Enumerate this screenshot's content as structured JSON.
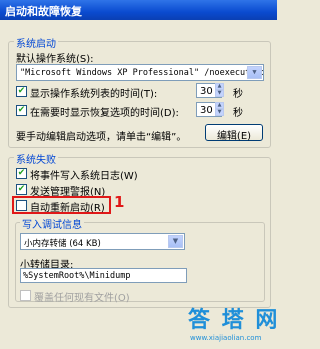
{
  "window": {
    "title": "启动和故障恢复"
  },
  "system_startup": {
    "legend": "系统启动",
    "default_os_label": "默认操作系统(S):",
    "default_os_value": "\"Microsoft Windows XP Professional\" /noexecute=optin",
    "show_os_list": {
      "checked": true,
      "label": "显示操作系统列表的时间(T):",
      "value": "30",
      "unit": "秒"
    },
    "show_recovery": {
      "checked": true,
      "label": "在需要时显示恢复选项的时间(D):",
      "value": "30",
      "unit": "秒"
    },
    "edit_hint": "要手动编辑启动选项，请单击“编辑”。",
    "edit_button": "编辑(E)"
  },
  "system_failure": {
    "legend": "系统失败",
    "write_event": {
      "checked": true,
      "label": "将事件写入系统日志(W)"
    },
    "send_alert": {
      "checked": true,
      "label": "发送管理警报(N)"
    },
    "auto_restart": {
      "checked": false,
      "label": "自动重新启动(R)"
    },
    "annotation_number": "1",
    "debug_legend": "写入调试信息",
    "debug_type": "小内存转储 (64 KB)",
    "dump_dir_label": "小转储目录:",
    "dump_dir_value": "%SystemRoot%\\Minidump",
    "overwrite": {
      "checked": false,
      "label": "覆盖任何现有文件(O)"
    }
  },
  "watermark": {
    "text_cn": "答 塔 网",
    "text_url": "www.xiajiaolian.com"
  },
  "icons": {
    "check": "checkmark-icon",
    "dropdown": "chevron-down-icon",
    "spin": "spin-arrows-icon"
  },
  "colors": {
    "titlebar": "#0a4bd0",
    "legend": "#0046d5",
    "annotation": "#e01818",
    "dialog": "#ece9d8"
  }
}
